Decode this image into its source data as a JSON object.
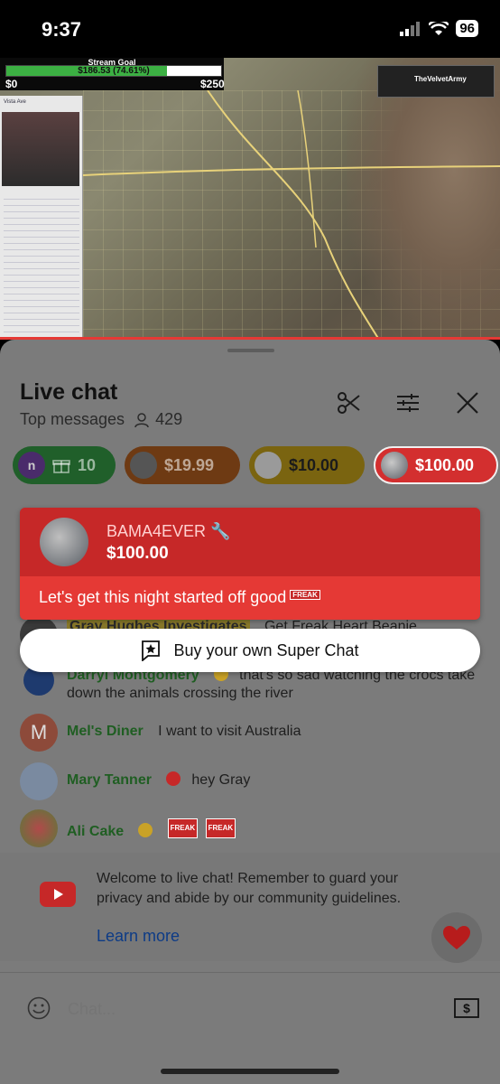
{
  "status_bar": {
    "time": "9:37",
    "battery": "96"
  },
  "stream": {
    "goal_label": "Stream Goal",
    "goal_value": "$186.53 (74.61%)",
    "goal_fraction": 0.7461,
    "goal_min": "$0",
    "goal_max": "$250",
    "side_panel_title": "Vista Ave",
    "channel_name": "TheVelvetArmy"
  },
  "chat": {
    "title": "Live chat",
    "mode": "Top messages",
    "viewer_count": "429",
    "pills": [
      {
        "label": "10",
        "color": "#2e7d32"
      },
      {
        "label": "$19.99",
        "color": "#e65100"
      },
      {
        "label": "$10.00",
        "color": "#f9a825"
      },
      {
        "label": "$100.00",
        "color": "#d32f2f"
      }
    ],
    "super_chat": {
      "name": "BAMA4EVER",
      "amount": "$100.00",
      "message": "Let's get this night started off good",
      "emote": "FREAK"
    },
    "buy_button": "Buy your own Super Chat",
    "messages": [
      {
        "author": "Gray Hughes Investigates",
        "text": "Get Freak Heart Beanie"
      },
      {
        "author": "Darryl Montgomery",
        "text": "that's so sad watching the crocs take down the animals crossing the river"
      },
      {
        "author": "Mel's Diner",
        "initial": "M",
        "text": "I want to visit Australia"
      },
      {
        "author": "Mary Tanner",
        "text": "hey Gray"
      },
      {
        "author": "Ali Cake",
        "text": "",
        "emotes": [
          "FREAK",
          "FREAK"
        ]
      }
    ],
    "welcome_text": "Welcome to live chat! Remember to guard your privacy and abide by our community guidelines.",
    "learn_more": "Learn more",
    "input_placeholder": "Chat..."
  },
  "colors": {
    "superchat_red": "#c62828",
    "author_green": "#1f5e22",
    "link_blue": "#0d3b86"
  }
}
